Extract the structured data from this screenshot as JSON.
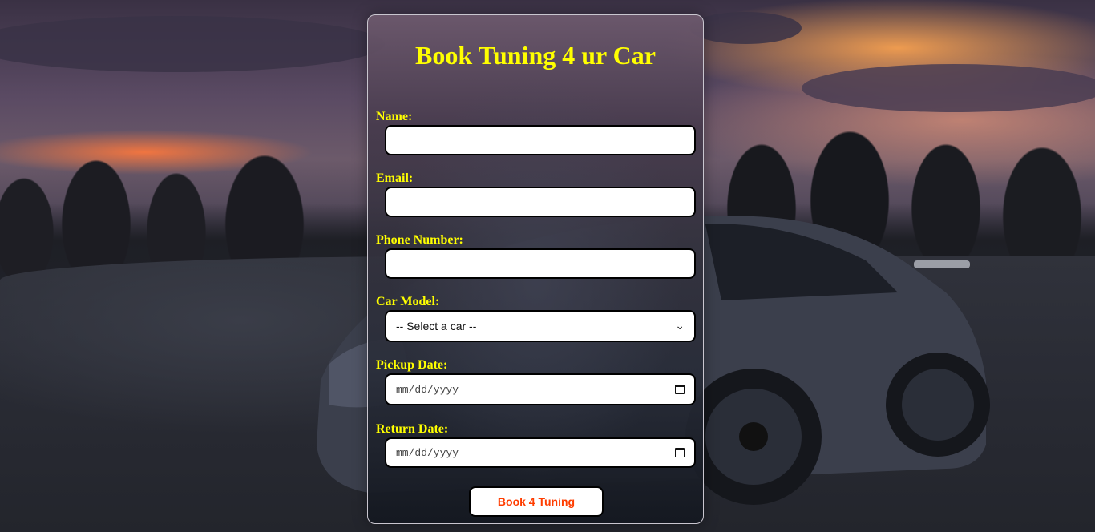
{
  "form": {
    "title": "Book Tuning 4 ur Car",
    "name_label": "Name:",
    "name_value": "",
    "email_label": "Email:",
    "email_value": "",
    "phone_label": "Phone Number:",
    "phone_value": "",
    "car_label": "Car Model:",
    "car_selected": "-- Select a car --",
    "pickup_label": "Pickup Date:",
    "pickup_placeholder": "mm/dd/yyyy",
    "return_label": "Return Date:",
    "return_placeholder": "mm/dd/yyyy",
    "submit_label": "Book 4 Tuning"
  },
  "icons": {
    "select": "chevron-down-icon",
    "date": "calendar-icon"
  },
  "colors": {
    "label": "#ffff00",
    "title": "#ffff00",
    "button_text": "#ff3d00",
    "input_bg": "#ffffff"
  }
}
